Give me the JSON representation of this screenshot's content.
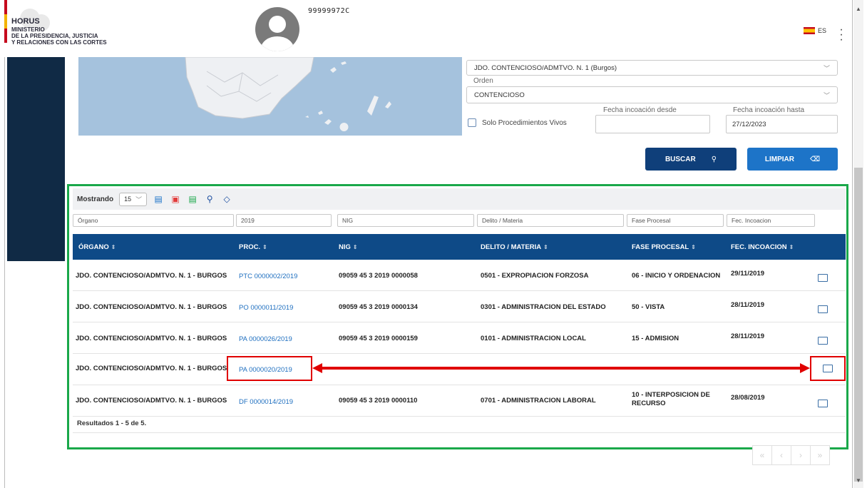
{
  "header": {
    "brand_title": "HORUS",
    "brand_line1": "MINISTERIO",
    "brand_line2": "DE LA PRESIDENCIA, JUSTICIA",
    "brand_line3": "Y RELACIONES CON LAS CORTES",
    "user_id": "99999972C",
    "language": "ES"
  },
  "form": {
    "organo_value": "JDO. CONTENCIOSO/ADMTVO. N. 1 (Burgos)",
    "orden_label": "Orden",
    "orden_value": "CONTENCIOSO",
    "solo_vivos_label": "Solo Procedimientos Vivos",
    "fecha_desde_label": "Fecha incoación desde",
    "fecha_desde_value": "",
    "fecha_hasta_label": "Fecha incoación hasta",
    "fecha_hasta_value": "27/12/2023",
    "buscar_label": "BUSCAR",
    "limpiar_label": "LIMPIAR"
  },
  "toolbar": {
    "showing_label": "Mostrando",
    "page_size": "15",
    "export_icons": [
      "csv-icon",
      "pdf-icon",
      "excel-icon",
      "search-icon",
      "eraser-icon"
    ]
  },
  "filters": {
    "organo": "Órgano",
    "proc": "2019",
    "nig": "NIG",
    "delito": "Delito / Materia",
    "fase": "Fase Procesal",
    "fecha": "Fec. Incoacion"
  },
  "table": {
    "headers": {
      "organo": "ÓRGANO",
      "proc": "PROC.",
      "nig": "NIG",
      "delito": "DELITO / MATERIA",
      "fase": "FASE PROCESAL",
      "fecha": "FEC. INCOACION"
    },
    "rows": [
      {
        "organo": "JDO. CONTENCIOSO/ADMTVO. N. 1 - BURGOS",
        "proc": "PTC 0000002/2019",
        "nig": "09059 45 3 2019 0000058",
        "delito": "0501 - EXPROPIACION FORZOSA",
        "fase": "06 - INICIO Y ORDENACION",
        "fecha": "29/11/2019"
      },
      {
        "organo": "JDO. CONTENCIOSO/ADMTVO. N. 1 - BURGOS",
        "proc": "PO 0000011/2019",
        "nig": "09059 45 3 2019 0000134",
        "delito": "0301 - ADMINISTRACION DEL ESTADO",
        "fase": "50 - VISTA",
        "fecha": "28/11/2019"
      },
      {
        "organo": "JDO. CONTENCIOSO/ADMTVO. N. 1 - BURGOS",
        "proc": "PA 0000026/2019",
        "nig": "09059 45 3 2019 0000159",
        "delito": "0101 - ADMINISTRACION LOCAL",
        "fase": "15 - ADMISION",
        "fecha": "28/11/2019"
      },
      {
        "organo": "JDO. CONTENCIOSO/ADMTVO. N. 1 - BURGOS",
        "proc": "PA 0000020/2019",
        "nig": "",
        "delito": "",
        "fase": "",
        "fecha": ""
      },
      {
        "organo": "JDO. CONTENCIOSO/ADMTVO. N. 1 - BURGOS",
        "proc": "DF 0000014/2019",
        "nig": "09059 45 3 2019 0000110",
        "delito": "0701 - ADMINISTRACION LABORAL",
        "fase": "10 - INTERPOSICION DE RECURSO",
        "fecha": "28/08/2019"
      }
    ],
    "results_text": "Resultados 1 - 5 de 5."
  },
  "pager": [
    "«",
    "‹",
    "›",
    "»"
  ],
  "colors": {
    "header_bg": "#0e4a87",
    "highlight": "#1aa84a",
    "annotation": "#e00000"
  }
}
